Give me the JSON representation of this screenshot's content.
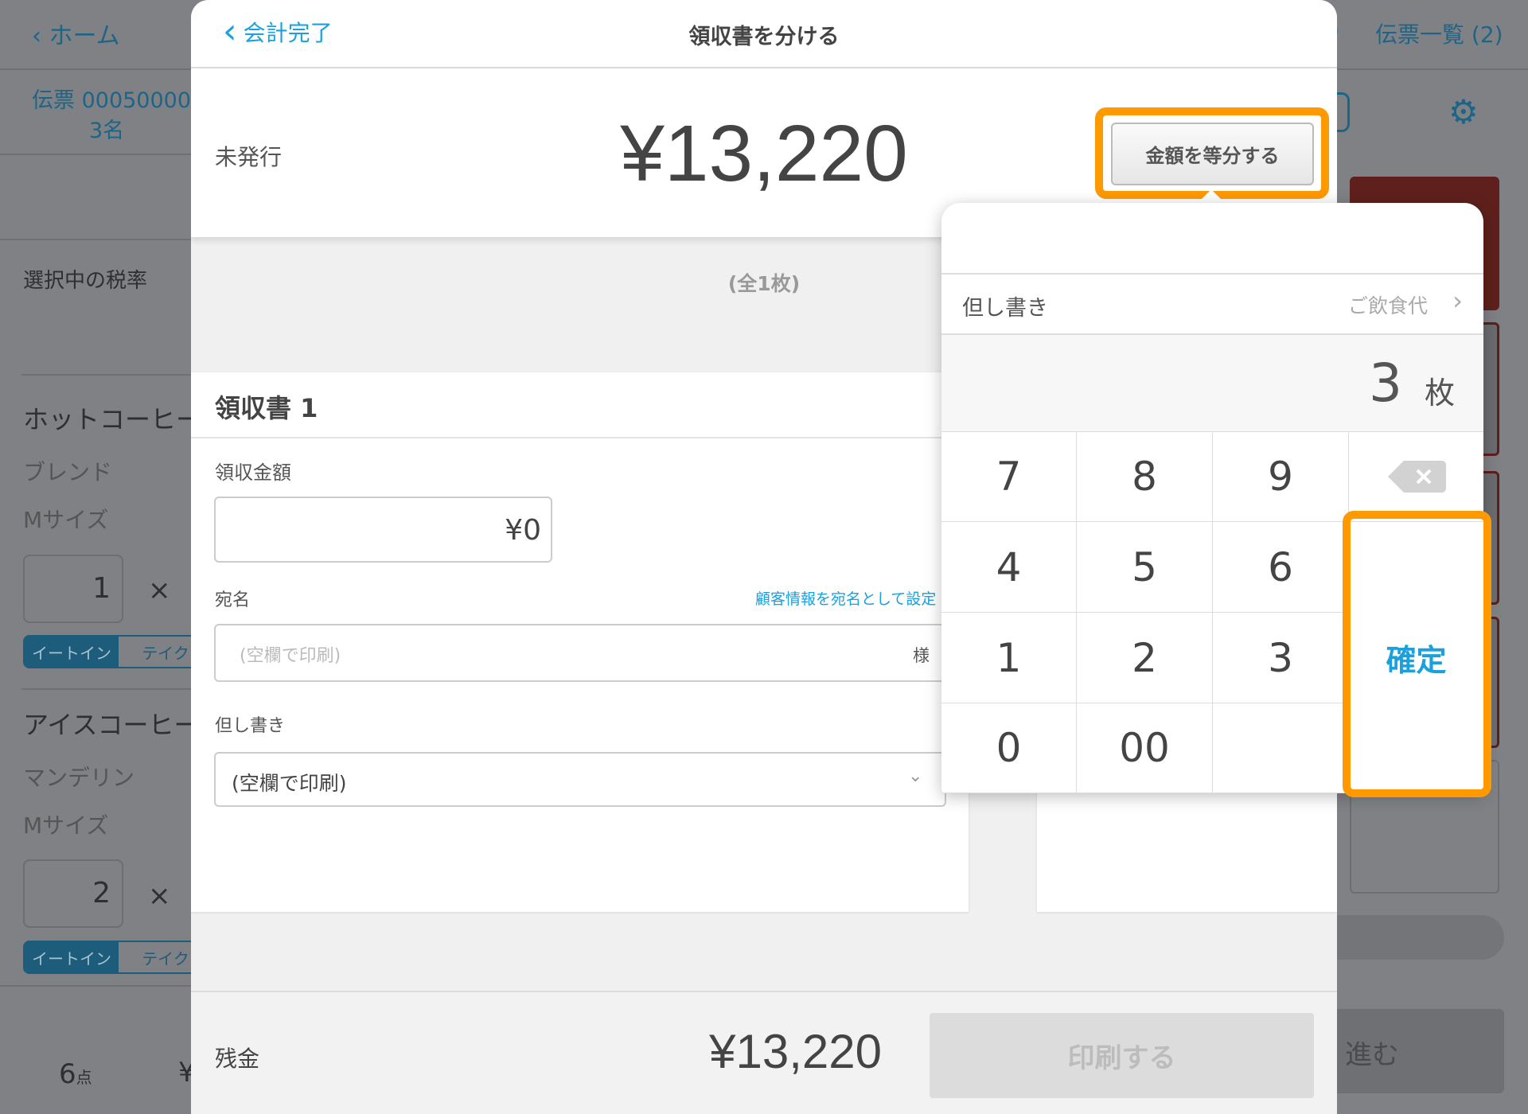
{
  "background": {
    "home_label": "ホーム",
    "slip_number": "伝票 00050000",
    "guests": "3名",
    "tax_rate_label": "選択中の税率",
    "slip_list_label": "伝票一覧 (2)",
    "partial_paren": ")",
    "items": [
      {
        "name": "ホットコーヒー",
        "variant": "ブレンド",
        "size": "Mサイズ",
        "qty": "1"
      },
      {
        "name": "アイスコーヒー",
        "variant": "マンデリン",
        "size": "Mサイズ",
        "qty": "2"
      }
    ],
    "times": "×",
    "eat_in": "イートイン",
    "takeout": "テイク",
    "count": "6",
    "count_unit": "点",
    "yen_partial": "¥",
    "proceed": "進む"
  },
  "modal": {
    "back_label": "会計完了",
    "title": "領収書を分ける",
    "status": "未発行",
    "total": "¥13,220",
    "split_button": "金額を等分する",
    "sheet_count": "(全1枚)",
    "receipt": {
      "title": "領収書 1",
      "amount_label": "領収金額",
      "amount_value": "¥0",
      "addressee_label": "宛名",
      "customer_link": "顧客情報を宛名として設定",
      "addressee_placeholder": "(空欄で印刷)",
      "honorific": "様",
      "proviso_label": "但し書き",
      "proviso_value": "(空欄で印刷)"
    },
    "remaining_label": "残金",
    "remaining_value": "¥13,220",
    "print_button": "印刷する"
  },
  "popover": {
    "proviso_label": "但し書き",
    "proviso_value": "ご飲食代",
    "count_value": "3",
    "count_unit": "枚",
    "keys": [
      "7",
      "8",
      "9",
      "4",
      "5",
      "6",
      "1",
      "2",
      "3",
      "0",
      "00"
    ],
    "confirm": "確定"
  },
  "colors": {
    "accent": "#1aa0dc",
    "highlight": "#ff9900"
  }
}
